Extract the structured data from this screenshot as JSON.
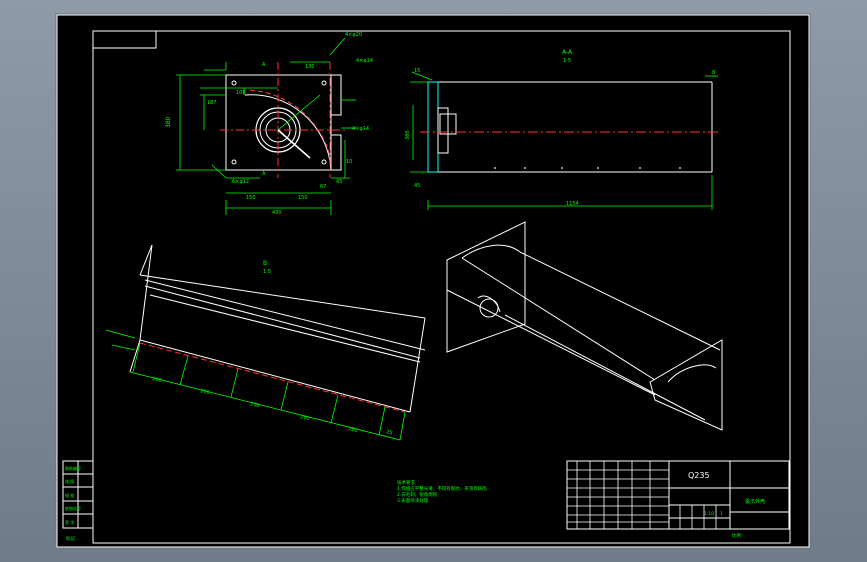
{
  "material": "Q235",
  "sections": {
    "a_a": "A-A",
    "b": "B",
    "a_marker": "A"
  },
  "scale_note": "1:5",
  "dimensions": {
    "top_overall_width": "430",
    "bottom_left": "150",
    "bottom_mid": "150",
    "hole_note": "6×φ12",
    "top_r": "130",
    "top_left_small": "100",
    "left_height": "380",
    "left_small": "187",
    "right_67": "67",
    "right_45": "45",
    "right_10": "10",
    "slot_note_top": "4×φ20",
    "slot_note_right": "4×φ14",
    "slot_note_side": "4×φ14",
    "side_overall_length": "1154",
    "side_height": "380",
    "side_small_15": "15",
    "side_small_8": "8",
    "bottom_spacing": "200",
    "bottom_end": "25"
  },
  "notes": [
    "技术要求",
    "1.焊缝应平整光滑，不得有裂纹、夹渣等缺陷",
    "2.去毛刺，锐角倒钝",
    "3.表面喷漆处理"
  ],
  "title_block": {
    "part_name": "拔爪外壳",
    "scale": "1:10",
    "qty": "1"
  },
  "left_block": [
    "图纸编号",
    "描 图",
    "描 校",
    "底图总号",
    "签 字"
  ],
  "bottom_labels": {
    "left": "标记",
    "right": "比例"
  },
  "colors": {
    "background": "#000000",
    "line": "#ffffff",
    "dimension": "#00ff00",
    "centerline": "#ff2222",
    "hidden": "#00ffff",
    "accent": "#ff00ff",
    "highlight": "#ffff00"
  }
}
